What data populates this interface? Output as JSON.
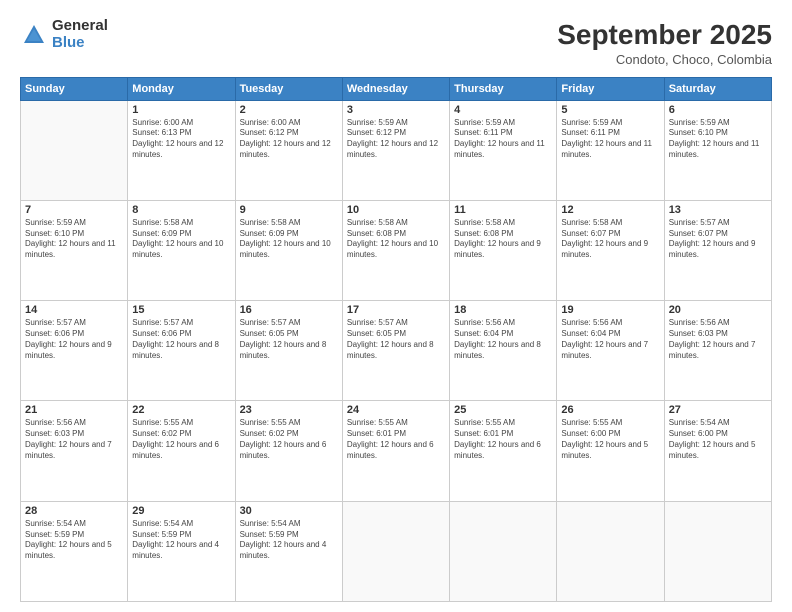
{
  "header": {
    "logo": {
      "general": "General",
      "blue": "Blue"
    },
    "title": "September 2025",
    "subtitle": "Condoto, Choco, Colombia"
  },
  "columns": [
    "Sunday",
    "Monday",
    "Tuesday",
    "Wednesday",
    "Thursday",
    "Friday",
    "Saturday"
  ],
  "weeks": [
    [
      {
        "day": "",
        "sunrise": "",
        "sunset": "",
        "daylight": ""
      },
      {
        "day": "1",
        "sunrise": "6:00 AM",
        "sunset": "6:13 PM",
        "daylight": "12 hours and 12 minutes."
      },
      {
        "day": "2",
        "sunrise": "6:00 AM",
        "sunset": "6:12 PM",
        "daylight": "12 hours and 12 minutes."
      },
      {
        "day": "3",
        "sunrise": "5:59 AM",
        "sunset": "6:12 PM",
        "daylight": "12 hours and 12 minutes."
      },
      {
        "day": "4",
        "sunrise": "5:59 AM",
        "sunset": "6:11 PM",
        "daylight": "12 hours and 11 minutes."
      },
      {
        "day": "5",
        "sunrise": "5:59 AM",
        "sunset": "6:11 PM",
        "daylight": "12 hours and 11 minutes."
      },
      {
        "day": "6",
        "sunrise": "5:59 AM",
        "sunset": "6:10 PM",
        "daylight": "12 hours and 11 minutes."
      }
    ],
    [
      {
        "day": "7",
        "sunrise": "5:59 AM",
        "sunset": "6:10 PM",
        "daylight": "12 hours and 11 minutes."
      },
      {
        "day": "8",
        "sunrise": "5:58 AM",
        "sunset": "6:09 PM",
        "daylight": "12 hours and 10 minutes."
      },
      {
        "day": "9",
        "sunrise": "5:58 AM",
        "sunset": "6:09 PM",
        "daylight": "12 hours and 10 minutes."
      },
      {
        "day": "10",
        "sunrise": "5:58 AM",
        "sunset": "6:08 PM",
        "daylight": "12 hours and 10 minutes."
      },
      {
        "day": "11",
        "sunrise": "5:58 AM",
        "sunset": "6:08 PM",
        "daylight": "12 hours and 9 minutes."
      },
      {
        "day": "12",
        "sunrise": "5:58 AM",
        "sunset": "6:07 PM",
        "daylight": "12 hours and 9 minutes."
      },
      {
        "day": "13",
        "sunrise": "5:57 AM",
        "sunset": "6:07 PM",
        "daylight": "12 hours and 9 minutes."
      }
    ],
    [
      {
        "day": "14",
        "sunrise": "5:57 AM",
        "sunset": "6:06 PM",
        "daylight": "12 hours and 9 minutes."
      },
      {
        "day": "15",
        "sunrise": "5:57 AM",
        "sunset": "6:06 PM",
        "daylight": "12 hours and 8 minutes."
      },
      {
        "day": "16",
        "sunrise": "5:57 AM",
        "sunset": "6:05 PM",
        "daylight": "12 hours and 8 minutes."
      },
      {
        "day": "17",
        "sunrise": "5:57 AM",
        "sunset": "6:05 PM",
        "daylight": "12 hours and 8 minutes."
      },
      {
        "day": "18",
        "sunrise": "5:56 AM",
        "sunset": "6:04 PM",
        "daylight": "12 hours and 8 minutes."
      },
      {
        "day": "19",
        "sunrise": "5:56 AM",
        "sunset": "6:04 PM",
        "daylight": "12 hours and 7 minutes."
      },
      {
        "day": "20",
        "sunrise": "5:56 AM",
        "sunset": "6:03 PM",
        "daylight": "12 hours and 7 minutes."
      }
    ],
    [
      {
        "day": "21",
        "sunrise": "5:56 AM",
        "sunset": "6:03 PM",
        "daylight": "12 hours and 7 minutes."
      },
      {
        "day": "22",
        "sunrise": "5:55 AM",
        "sunset": "6:02 PM",
        "daylight": "12 hours and 6 minutes."
      },
      {
        "day": "23",
        "sunrise": "5:55 AM",
        "sunset": "6:02 PM",
        "daylight": "12 hours and 6 minutes."
      },
      {
        "day": "24",
        "sunrise": "5:55 AM",
        "sunset": "6:01 PM",
        "daylight": "12 hours and 6 minutes."
      },
      {
        "day": "25",
        "sunrise": "5:55 AM",
        "sunset": "6:01 PM",
        "daylight": "12 hours and 6 minutes."
      },
      {
        "day": "26",
        "sunrise": "5:55 AM",
        "sunset": "6:00 PM",
        "daylight": "12 hours and 5 minutes."
      },
      {
        "day": "27",
        "sunrise": "5:54 AM",
        "sunset": "6:00 PM",
        "daylight": "12 hours and 5 minutes."
      }
    ],
    [
      {
        "day": "28",
        "sunrise": "5:54 AM",
        "sunset": "5:59 PM",
        "daylight": "12 hours and 5 minutes."
      },
      {
        "day": "29",
        "sunrise": "5:54 AM",
        "sunset": "5:59 PM",
        "daylight": "12 hours and 4 minutes."
      },
      {
        "day": "30",
        "sunrise": "5:54 AM",
        "sunset": "5:59 PM",
        "daylight": "12 hours and 4 minutes."
      },
      {
        "day": "",
        "sunrise": "",
        "sunset": "",
        "daylight": ""
      },
      {
        "day": "",
        "sunrise": "",
        "sunset": "",
        "daylight": ""
      },
      {
        "day": "",
        "sunrise": "",
        "sunset": "",
        "daylight": ""
      },
      {
        "day": "",
        "sunrise": "",
        "sunset": "",
        "daylight": ""
      }
    ]
  ]
}
